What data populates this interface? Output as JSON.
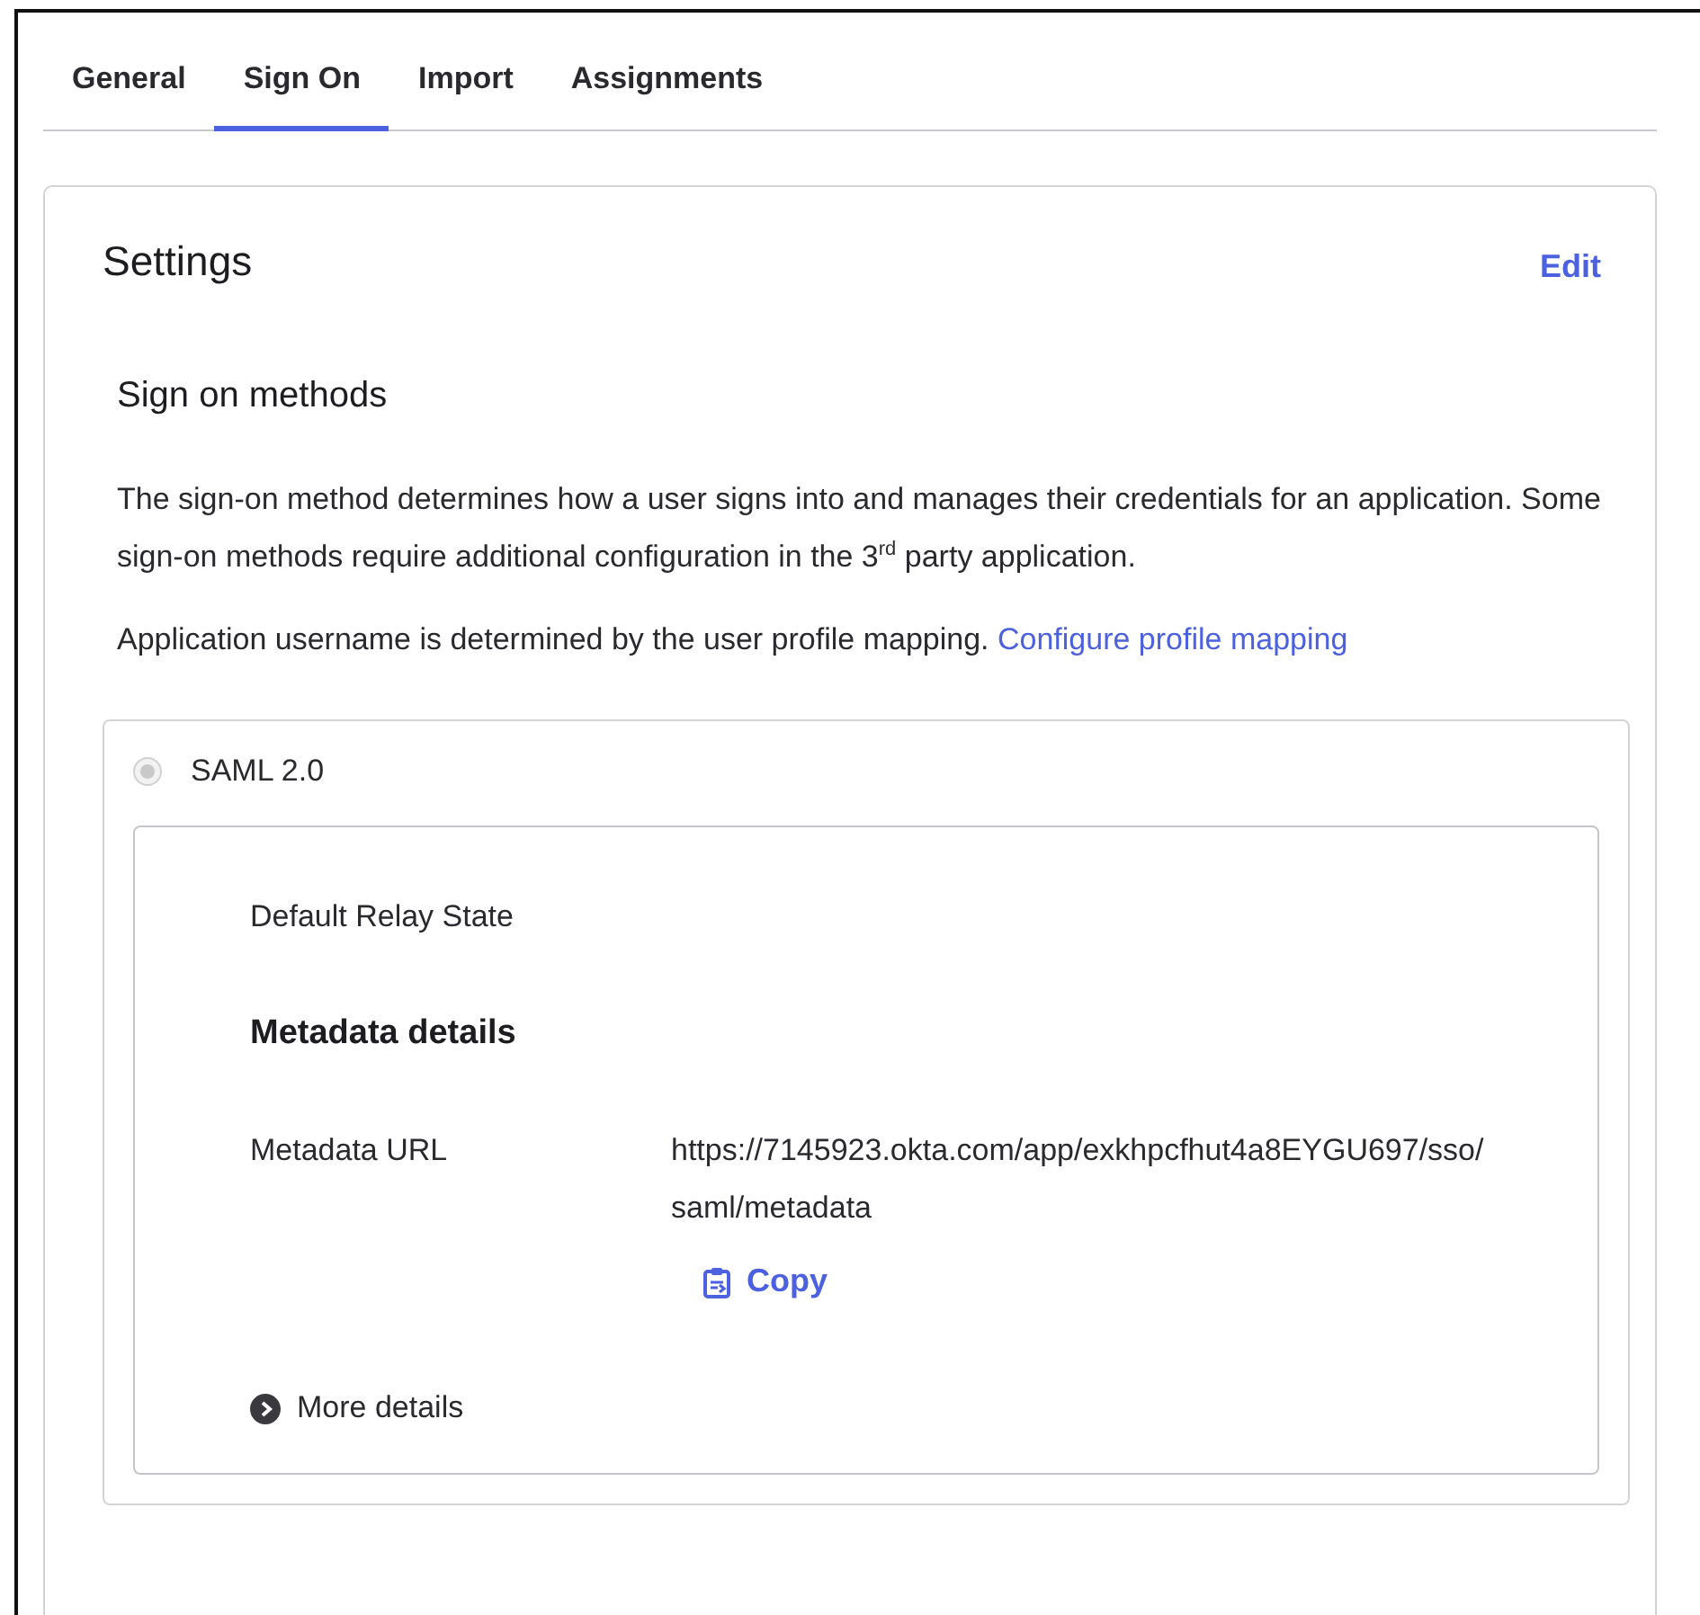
{
  "tabs": [
    {
      "label": "General",
      "selected": false
    },
    {
      "label": "Sign On",
      "selected": true
    },
    {
      "label": "Import",
      "selected": false
    },
    {
      "label": "Assignments",
      "selected": false
    }
  ],
  "settings": {
    "title": "Settings",
    "edit_link": "Edit",
    "section_title": "Sign on methods",
    "description": "The sign-on method determines how a user signs into and manages their credentials for an application. Some sign-on methods require additional configuration in the 3$^{rd}$ party application.",
    "mapping_text": "Application username is determined by the user profile mapping.",
    "mapping_link": "Configure profile mapping",
    "methods": [
      {
        "label": "SAML 2.0",
        "selected": true,
        "disabled": true,
        "relay_state_label": "Default Relay State",
        "metadata_title": "Metadata details",
        "metadata_url_label": "Metadata URL",
        "metadata_url": "https://7145923.okta.com/app/exkhpcfhut4a8EYGU697/sso/saml/metadata",
        "copy_button": "Copy",
        "more_details": "More details",
        "expanded": false
      }
    ]
  }
}
